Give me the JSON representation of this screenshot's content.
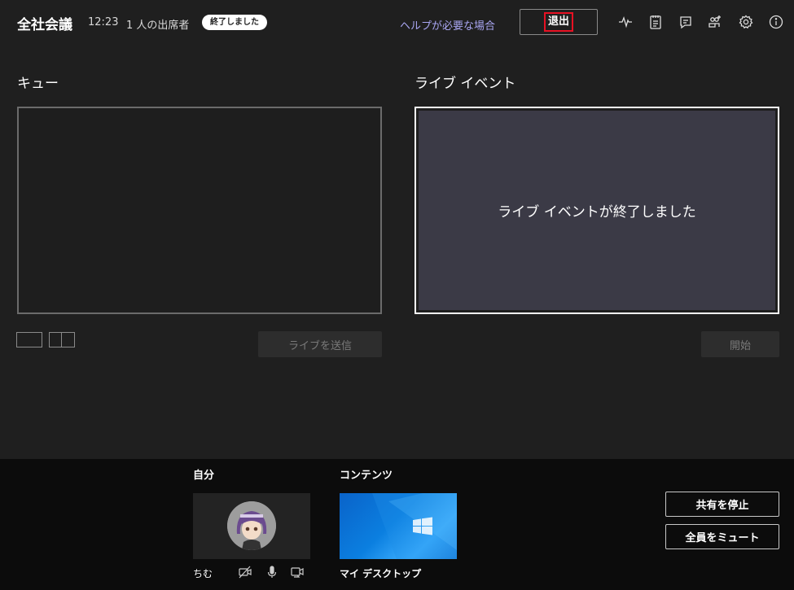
{
  "header": {
    "title": "全社会議",
    "time": "12:23",
    "attendees": "1 人の出席者",
    "status_badge": "終了しました",
    "help_link": "ヘルプが必要な場合",
    "leave_label": "退出"
  },
  "queue": {
    "title": "キュー",
    "send_live_label": "ライブを送信"
  },
  "live_event": {
    "title": "ライブ イベント",
    "ended_message": "ライブ イベントが終了しました",
    "start_label": "開始"
  },
  "bottom": {
    "self_heading": "自分",
    "self_name": "ちむ",
    "content_heading": "コンテンツ",
    "content_name": "マイ デスクトップ",
    "stop_sharing_label": "共有を停止",
    "mute_all_label": "全員をミュート"
  },
  "icons": {
    "health": "pulse-icon",
    "notes": "notes-icon",
    "chat": "chat-icon",
    "participants": "participants-icon",
    "settings": "gear-icon",
    "info": "info-icon"
  },
  "colors": {
    "background": "#1f1f1f",
    "bottom_bar": "#0c0c0c",
    "accent_link": "#a9a6f2",
    "highlight_red": "#e81123",
    "live_panel": "#3b3a46"
  }
}
